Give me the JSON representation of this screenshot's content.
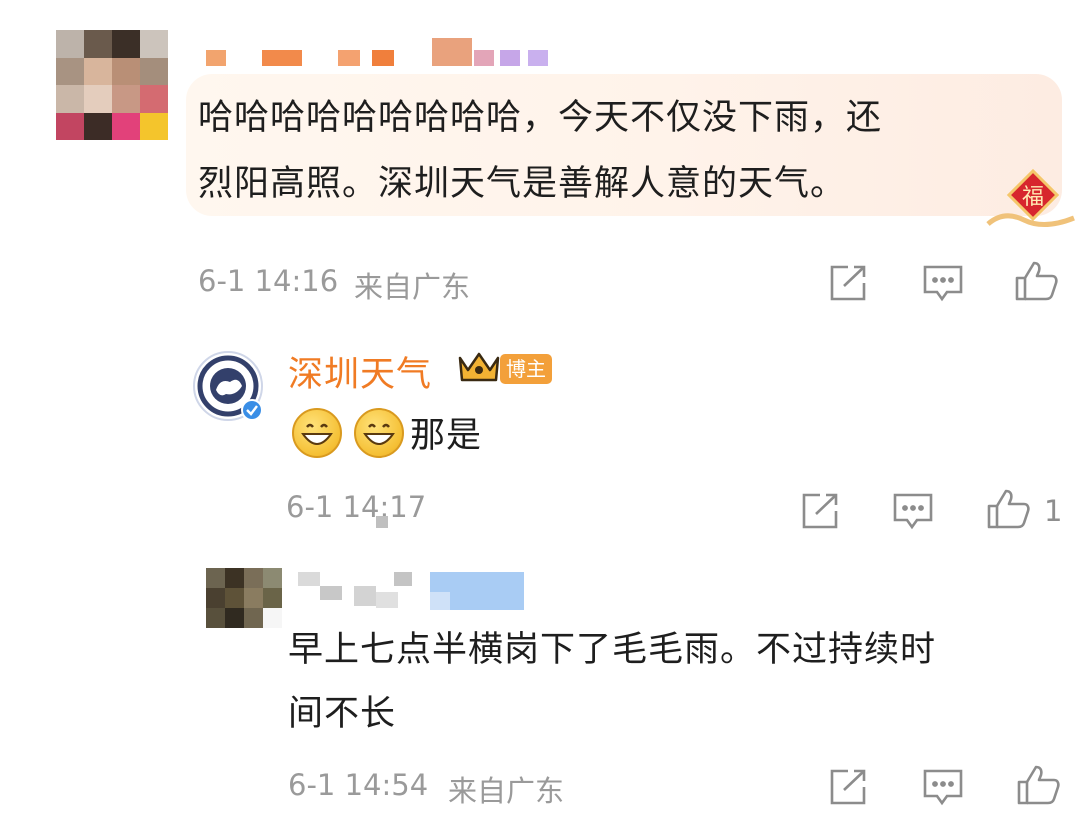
{
  "comments": [
    {
      "text_line1": "哈哈哈哈哈哈哈哈哈，今天不仅没下雨，还",
      "text_line2": "烈阳高照。深圳天气是善解人意的天气。",
      "time": "6-1 14:16",
      "location": "来自广东",
      "like_count": ""
    }
  ],
  "reply": {
    "username": "深圳天气",
    "badge": "博主",
    "text": "那是",
    "time": "6-1 14:17",
    "like_count": "1"
  },
  "reply2": {
    "text_line1": "早上七点半横岗下了毛毛雨。不过持续时",
    "text_line2": "间不长",
    "time": "6-1 14:54",
    "location": "来自广东"
  },
  "icons": [
    "share-icon",
    "comment-icon",
    "like-icon"
  ],
  "colors": {
    "username_orange": "#f07b24",
    "badge_bg": "#f3a03a",
    "meta_gray": "#9a9a9a"
  }
}
